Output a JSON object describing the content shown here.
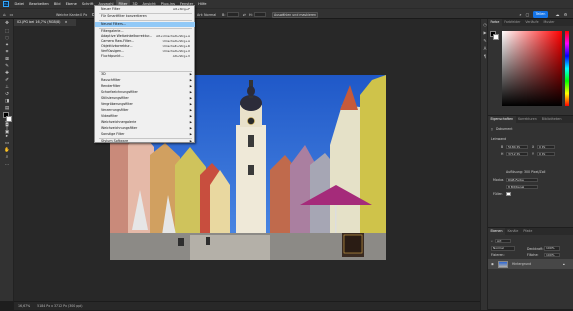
{
  "menubar": {
    "logo": "Ps",
    "items": [
      "Datei",
      "Bearbeiten",
      "Bild",
      "Ebene",
      "Schrift",
      "Auswahl",
      "Filter",
      "3D",
      "Ansicht",
      "Plug-ins",
      "Fenster",
      "Hilfe"
    ],
    "active": "Filter"
  },
  "options": {
    "soft_edge_label": "Weiche Kante:",
    "soft_edge_value": "0 Px",
    "antialias_label": "Glätten",
    "style_label": "Art:",
    "style_value": "Normal",
    "width_label": "B:",
    "height_label": "H:",
    "select_mask_btn": "Auswählen und maskieren ...",
    "share_label": "Teilen"
  },
  "document": {
    "tab_title": "02.JPG bei 16,7% (RGB/8)",
    "close_glyph": "×",
    "zoom": "16,67%",
    "doc_info": "5184 Px x 3712 Px (300 ppi)"
  },
  "filter_menu": {
    "items": [
      {
        "label": "Neuer Filter",
        "shortcut": "Alt+Strg+F",
        "submenu": false
      },
      {
        "sep": true
      },
      {
        "label": "Für Smartfilter konvertieren",
        "shortcut": "",
        "submenu": false
      },
      {
        "sep": true
      },
      {
        "label": "Neural Filters...",
        "shortcut": "",
        "submenu": false,
        "highlight": true
      },
      {
        "sep": true
      },
      {
        "label": "Filtergalerie...",
        "shortcut": "",
        "submenu": false
      },
      {
        "label": "Adaptive Weitwinkelkorrektur...",
        "shortcut": "Alt+Umschalt+Strg+A",
        "submenu": false
      },
      {
        "label": "Camera Raw-Filter...",
        "shortcut": "Umschalt+Strg+A",
        "submenu": false
      },
      {
        "label": "Objektivkorrektur...",
        "shortcut": "Umschalt+Strg+R",
        "submenu": false
      },
      {
        "label": "Verflüssigen...",
        "shortcut": "Umschalt+Strg+X",
        "submenu": false
      },
      {
        "label": "Fluchtpunkt...",
        "shortcut": "Alt+Strg+V",
        "submenu": false
      },
      {
        "sep": true
      },
      {
        "label": "3D",
        "shortcut": "",
        "submenu": true
      },
      {
        "label": "Rauschfilter",
        "shortcut": "",
        "submenu": true
      },
      {
        "label": "Renderfilter",
        "shortcut": "",
        "submenu": true
      },
      {
        "label": "Scharfzeichnungsfilter",
        "shortcut": "",
        "submenu": true
      },
      {
        "label": "Stilisierungsfilter",
        "shortcut": "",
        "submenu": true
      },
      {
        "label": "Vergröberungsfilter",
        "shortcut": "",
        "submenu": true
      },
      {
        "label": "Verzerrungsfilter",
        "shortcut": "",
        "submenu": true
      },
      {
        "label": "Videofilter",
        "shortcut": "",
        "submenu": true
      },
      {
        "label": "Weichzeichnergalerie",
        "shortcut": "",
        "submenu": true
      },
      {
        "label": "Weichzeichnungsfilter",
        "shortcut": "",
        "submenu": true
      },
      {
        "label": "Sonstige Filter",
        "shortcut": "",
        "submenu": true
      },
      {
        "sep": true
      },
      {
        "label": "Stylum Software",
        "shortcut": "",
        "submenu": true
      }
    ]
  },
  "color_panel": {
    "tabs": [
      "Farbe",
      "Farbfelder",
      "Verläufe",
      "Muster"
    ],
    "active_tab": "Farbe",
    "hue_color": "#ff0000"
  },
  "properties_panel": {
    "tabs": [
      "Eigenschaften",
      "Korrekturen",
      "Bibliotheken"
    ],
    "active_tab": "Eigenschaften",
    "doc_label": "Dokument",
    "section_canvas": "Leinwand",
    "w_label": "B",
    "w_value": "5184 Px",
    "h_label": "H",
    "h_value": "3712 Px",
    "x_label": "X",
    "x_value": "0 Px",
    "y_label": "Y",
    "y_value": "0 Px",
    "resolution": "Auflösung: 300 Pixel/Zoll",
    "mode_label": "Modus",
    "mode_value": "RGB-Farbe",
    "depth_value": "8 Bit/Kanal",
    "fill_label": "Füllen"
  },
  "layers_panel": {
    "tabs": [
      "Ebenen",
      "Kanäle",
      "Pfade"
    ],
    "active_tab": "Ebenen",
    "kind_label": "Art",
    "blend_mode": "Normal",
    "opacity_label": "Deckkraft:",
    "opacity_value": "100%",
    "lock_label": "Fixieren:",
    "fill_label": "Fläche:",
    "fill_value": "100%",
    "layer_name": "Hintergrund"
  },
  "colors": {
    "accent": "#1473e6",
    "menu_highlight": "#91c9f7",
    "chrome": "#323232",
    "canvas_bg": "#282828",
    "sky": "#2c67d6"
  }
}
